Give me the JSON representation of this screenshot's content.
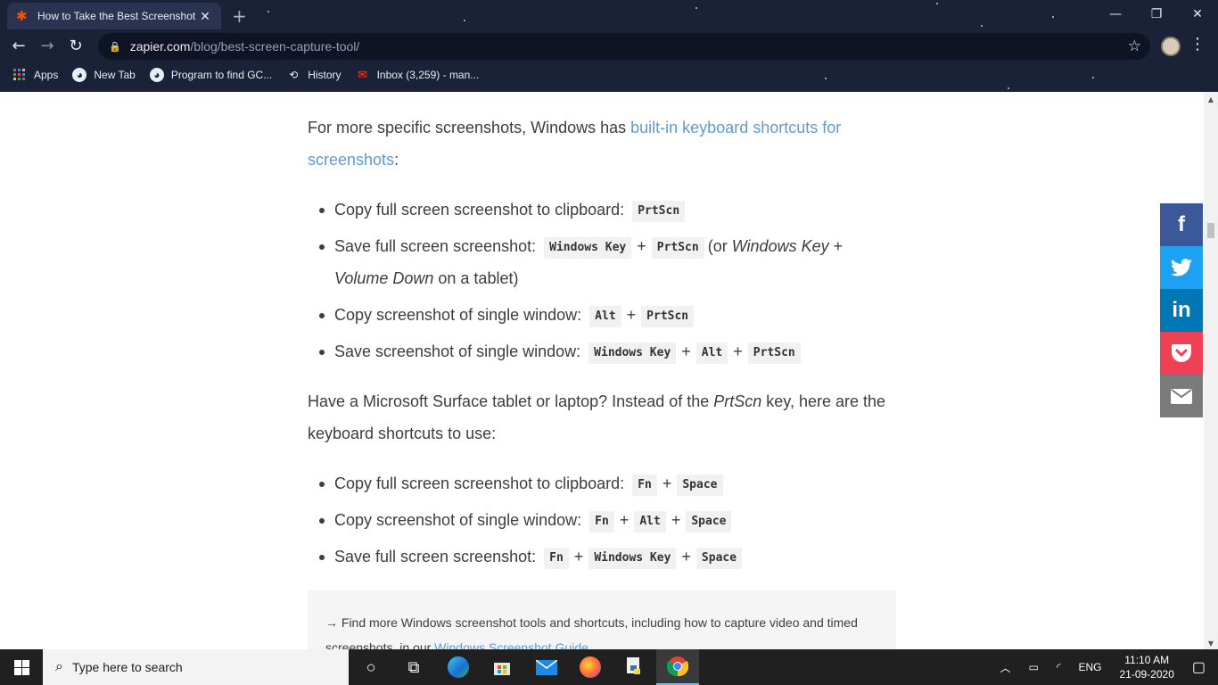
{
  "browser": {
    "tab_title": "How to Take the Best Screenshot",
    "tab_icon": "zapier-asterisk-icon",
    "new_tab_glyph": "+",
    "url_domain": "zapier.com",
    "url_path": "/blog/best-screen-capture-tool/",
    "bookmarks": [
      {
        "label": "Apps",
        "icon": "apps-grid-icon"
      },
      {
        "label": "New Tab",
        "icon": "globe-icon"
      },
      {
        "label": "Program to find GC...",
        "icon": "globe-icon"
      },
      {
        "label": "History",
        "icon": "history-icon"
      },
      {
        "label": "Inbox (3,259) - man...",
        "icon": "gmail-icon"
      }
    ]
  },
  "article": {
    "p1_text": "For more specific screenshots, Windows has ",
    "p1_link": "built-in keyboard shortcuts for screenshots",
    "p1_end": ":",
    "list1": {
      "i1_text": "Copy full screen screenshot to clipboard:",
      "i1_k1": "PrtScn",
      "i2_text": "Save full screen screenshot:",
      "i2_k1": "Windows Key",
      "i2_k2": "PrtScn",
      "i2_open": "(or ",
      "i2_em1": "Windows Key",
      "i2_em2": "Volume Down",
      "i2_close": " on a tablet)",
      "i3_text": "Copy screenshot of single window:",
      "i3_k1": "Alt",
      "i3_k2": "PrtScn",
      "i4_text": "Save screenshot of single window:",
      "i4_k1": "Windows Key",
      "i4_k2": "Alt",
      "i4_k3": "PrtScn"
    },
    "p2_a": "Have a Microsoft Surface tablet or laptop? Instead of the ",
    "p2_em": "PrtScn",
    "p2_b": " key, here are the keyboard shortcuts to use:",
    "list2": {
      "i1_text": "Copy full screen screenshot to clipboard:",
      "i1_k1": "Fn",
      "i1_k2": "Space",
      "i2_text": "Copy screenshot of single window:",
      "i2_k1": "Fn",
      "i2_k2": "Alt",
      "i2_k3": "Space",
      "i3_text": "Save full screen screenshot:",
      "i3_k1": "Fn",
      "i3_k2": "Windows Key",
      "i3_k3": "Space"
    },
    "plus": "+",
    "callout_text": "→ Find more Windows screenshot tools and shortcuts, including how to capture video and timed screenshots, in our ",
    "callout_link": "Windows Screenshot Guide",
    "callout_end": "."
  },
  "share": [
    {
      "name": "facebook",
      "color": "#3b5998",
      "glyph": "f"
    },
    {
      "name": "twitter",
      "color": "#1da1f2",
      "glyph": "🐦"
    },
    {
      "name": "linkedin",
      "color": "#0077b5",
      "glyph": "in"
    },
    {
      "name": "pocket",
      "color": "#ef4056",
      "glyph": "⌄"
    },
    {
      "name": "email",
      "color": "#7a7a7a",
      "glyph": "✉"
    }
  ],
  "taskbar": {
    "search_placeholder": "Type here to search",
    "language": "ENG",
    "time": "11:10 AM",
    "date": "21-09-2020"
  }
}
